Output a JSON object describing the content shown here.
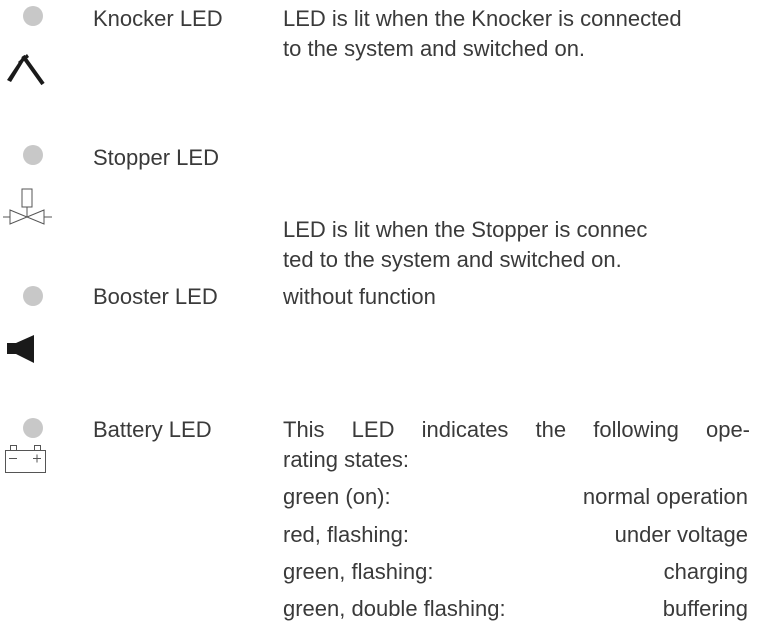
{
  "items": [
    {
      "label": "Knocker LED",
      "icon": "hammer-icon",
      "description_lines": [
        "LED is lit when the Knocker is connected",
        "to the system and switched on."
      ]
    },
    {
      "label": "Stopper LED",
      "icon": "valve-icon",
      "description_lines": [
        "LED is lit when the Stopper is connec",
        "ted to the system and switched on."
      ]
    },
    {
      "label": "Booster LED",
      "icon": "speaker-icon",
      "description_lines": [
        "without function"
      ]
    },
    {
      "label": "Battery LED",
      "icon": "battery-icon",
      "description_lines": [
        "This LED indicates the following ope-",
        "rating states:"
      ],
      "states": [
        {
          "condition": "green (on):",
          "meaning": "normal operation"
        },
        {
          "condition": "red, flashing:",
          "meaning": "under voltage"
        },
        {
          "condition": "green, flashing:",
          "meaning": "charging"
        },
        {
          "condition": "green, double flashing:",
          "meaning": "buffering"
        }
      ]
    }
  ],
  "colors": {
    "led": "#c8c8c8",
    "text": "#3a3a3a",
    "icon": "#1a1a1a"
  }
}
